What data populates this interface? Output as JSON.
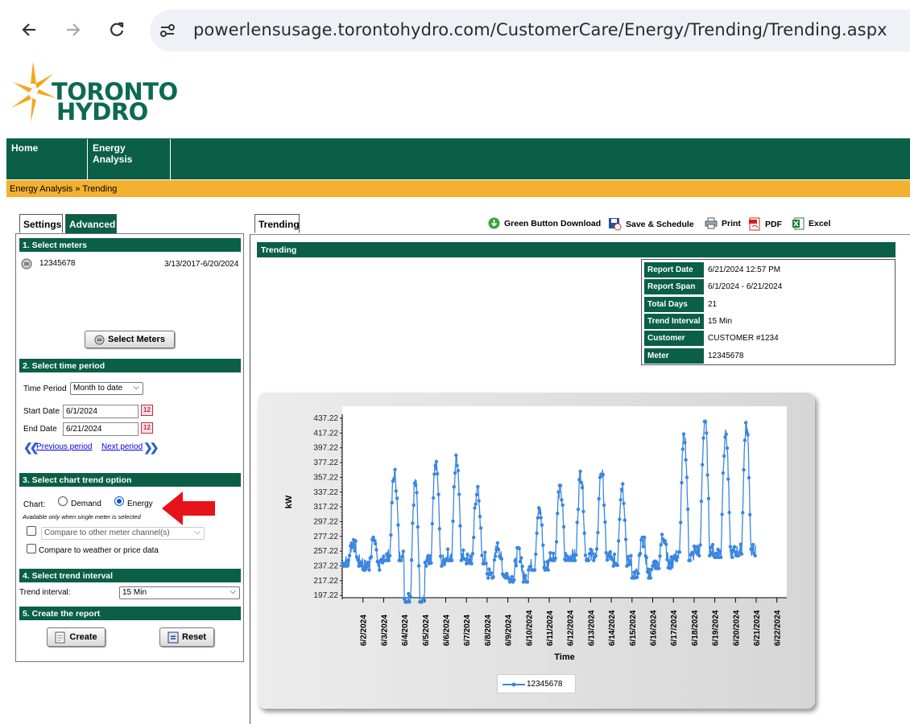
{
  "browser": {
    "url": "powerlensusage.torontohydro.com/CustomerCare/Energy/Trending/Trending.aspx"
  },
  "logo": {
    "line1": "TORONTO",
    "line2": "HYDRO",
    "mark": "®"
  },
  "nav": {
    "items": [
      "Home",
      "Energy",
      "Analysis"
    ],
    "breadcrumb": "Energy Analysis » Trending"
  },
  "left": {
    "tabs": [
      "Settings",
      "Advanced"
    ],
    "sec1": "1. Select meters",
    "meter_id": "12345678",
    "meter_range": "3/13/2017-6/20/2024",
    "select_meters_btn": "Select Meters",
    "sec2": "2. Select time period",
    "time_period_label": "Time Period",
    "time_period_value": "Month to date",
    "start_label": "Start Date",
    "start_value": "6/1/2024",
    "end_label": "End Date",
    "end_value": "6/21/2024",
    "prev_period": "Previous period",
    "next_period": "Next period",
    "sec3": "3. Select chart trend option",
    "chart_label": "Chart:",
    "demand_label": "Demand",
    "energy_label": "Energy",
    "note": "Available only when single meter is selected",
    "compare_channel": "Compare to other meter channel(s)",
    "compare_weather": "Compare to weather or price data",
    "sec4": "4. Select trend interval",
    "trend_interval_label": "Trend interval:",
    "trend_interval_value": "15 Min",
    "sec5": "5. Create the report",
    "create_btn": "Create",
    "reset_btn": "Reset"
  },
  "right": {
    "tab": "Trending",
    "tools": [
      "Green Button Download",
      "Save & Schedule",
      "Print",
      "PDF",
      "Excel"
    ],
    "section_title": "Trending",
    "info": [
      {
        "label": "Report Date",
        "value": "6/21/2024 12:57 PM"
      },
      {
        "label": "Report Span",
        "value": "6/1/2024 - 6/21/2024"
      },
      {
        "label": "Total Days",
        "value": "21"
      },
      {
        "label": "Trend Interval",
        "value": "15 Min"
      },
      {
        "label": "Customer",
        "value": "CUSTOMER #1234"
      },
      {
        "label": "Meter",
        "value": "12345678"
      }
    ]
  },
  "chart_data": {
    "type": "line",
    "xlabel": "Time",
    "ylabel": "kW",
    "y_ticks": [
      "437.22",
      "417.22",
      "397.22",
      "377.22",
      "357.22",
      "337.22",
      "317.22",
      "297.22",
      "277.22",
      "257.22",
      "237.22",
      "217.22",
      "197.22"
    ],
    "ylim": [
      197.22,
      437.22
    ],
    "x_ticks": [
      "6/2/2024",
      "6/3/2024",
      "6/4/2024",
      "6/5/2024",
      "6/6/2024",
      "6/7/2024",
      "6/8/2024",
      "6/9/2024",
      "6/10/2024",
      "6/11/2024",
      "6/12/2024",
      "6/13/2024",
      "6/14/2024",
      "6/15/2024",
      "6/16/2024",
      "6/17/2024",
      "6/18/2024",
      "6/19/2024",
      "6/20/2024",
      "6/21/2024",
      "6/22/2024"
    ],
    "series": [
      {
        "name": "12345678",
        "color": "#3a86e0",
        "daily": [
          {
            "date": "6/1/2024",
            "low": 255,
            "high": 282
          },
          {
            "date": "6/2/2024",
            "low": 250,
            "high": 285
          },
          {
            "date": "6/3/2024",
            "low": 262,
            "high": 370
          },
          {
            "date": "6/4/2024",
            "low": 210,
            "high": 358
          },
          {
            "date": "6/5/2024",
            "low": 255,
            "high": 380
          },
          {
            "date": "6/6/2024",
            "low": 262,
            "high": 388
          },
          {
            "date": "6/7/2024",
            "low": 258,
            "high": 350
          },
          {
            "date": "6/8/2024",
            "low": 240,
            "high": 278
          },
          {
            "date": "6/9/2024",
            "low": 235,
            "high": 272
          },
          {
            "date": "6/10/2024",
            "low": 250,
            "high": 322
          },
          {
            "date": "6/11/2024",
            "low": 262,
            "high": 350
          },
          {
            "date": "6/12/2024",
            "low": 262,
            "high": 368
          },
          {
            "date": "6/13/2024",
            "low": 262,
            "high": 370
          },
          {
            "date": "6/14/2024",
            "low": 255,
            "high": 352
          },
          {
            "date": "6/15/2024",
            "low": 240,
            "high": 285
          },
          {
            "date": "6/16/2024",
            "low": 252,
            "high": 290
          },
          {
            "date": "6/17/2024",
            "low": 262,
            "high": 415
          },
          {
            "date": "6/18/2024",
            "low": 268,
            "high": 435
          },
          {
            "date": "6/19/2024",
            "low": 266,
            "high": 420
          },
          {
            "date": "6/20/2024",
            "low": 268,
            "high": 430
          }
        ]
      }
    ]
  }
}
